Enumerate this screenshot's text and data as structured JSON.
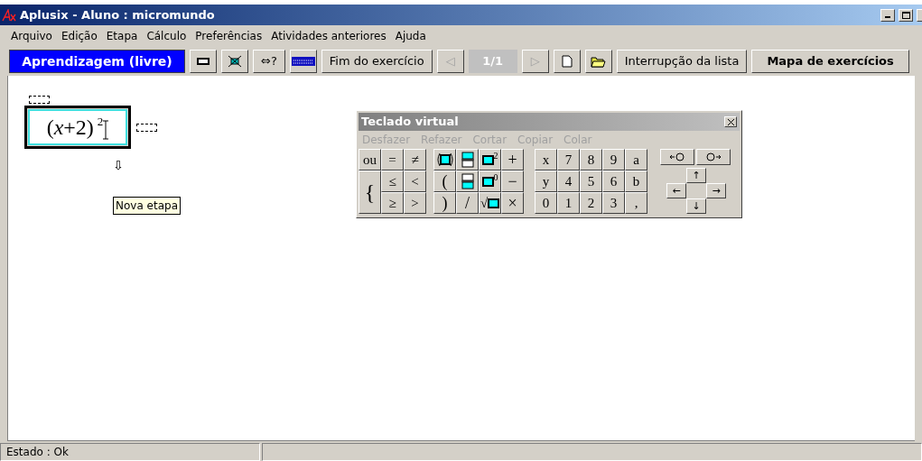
{
  "window": {
    "title": "Aplusix - Aluno : micromundo"
  },
  "menu": [
    "Arquivo",
    "Edição",
    "Etapa",
    "Cálculo",
    "Preferências",
    "Atividades anteriores",
    "Ajuda"
  ],
  "toolbar": [
    {
      "kind": "mode",
      "label": "Aprendizagem (livre)"
    },
    {
      "kind": "rectangle"
    },
    {
      "kind": "crossbox"
    },
    {
      "kind": "text",
      "label": "⇔?"
    },
    {
      "kind": "keyboard"
    },
    {
      "kind": "text",
      "label": "Fim do exercício",
      "disabled": false
    },
    {
      "kind": "text",
      "label": "◁",
      "disabled": true
    },
    {
      "kind": "counter",
      "label": "1/1"
    },
    {
      "kind": "text",
      "label": "▷",
      "disabled": true
    },
    {
      "kind": "document"
    },
    {
      "kind": "folder"
    },
    {
      "kind": "text",
      "label": "Interrupção da lista",
      "disabled": false
    },
    {
      "kind": "bold",
      "label": "Mapa de exercícios"
    }
  ],
  "workspace": {
    "expression": "(*x*+2)",
    "exponent": "2",
    "step_arrow": "⇩",
    "tooltip": "Nova etapa"
  },
  "keyboard": {
    "title": "Teclado virtual",
    "actions": [
      {
        "label": "Desfazer",
        "disabled": true
      },
      {
        "label": "Refazer",
        "disabled": true
      },
      {
        "label": "Cortar",
        "disabled": true
      },
      {
        "label": "Copiar",
        "disabled": true
      },
      {
        "label": "Colar",
        "disabled": true
      }
    ],
    "relations": [
      "ou",
      "=",
      "≠",
      "{",
      "≤",
      "<",
      "≥",
      ">"
    ],
    "operators": [
      {
        "kind": "parenbox"
      },
      {
        "kind": "numerator"
      },
      {
        "kind": "power",
        "label": "2"
      },
      {
        "kind": "text",
        "label": "+"
      },
      {
        "kind": "text",
        "label": "("
      },
      {
        "kind": "denominator"
      },
      {
        "kind": "power",
        "label": "0"
      },
      {
        "kind": "text",
        "label": "−"
      },
      {
        "kind": "text",
        "label": ")"
      },
      {
        "kind": "text",
        "label": "/"
      },
      {
        "kind": "root",
        "label": "√"
      },
      {
        "kind": "text",
        "label": "×"
      }
    ],
    "digits": [
      "x",
      "7",
      "8",
      "9",
      "a",
      "y",
      "4",
      "5",
      "6",
      "b",
      "0",
      "1",
      "2",
      "3",
      ","
    ],
    "arrows": [
      "↑",
      "←",
      "→",
      "↓"
    ]
  },
  "status_bar": {
    "text": "Estado : Ok"
  }
}
